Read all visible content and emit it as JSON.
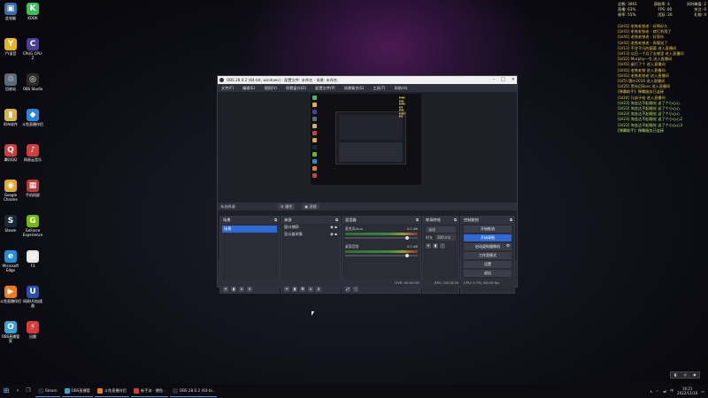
{
  "desktop": {
    "icons": [
      {
        "label": "此电脑",
        "glyph": "▣",
        "color": "#3a6ea5"
      },
      {
        "label": "KOOK",
        "glyph": "K",
        "color": "#3cbf5c"
      },
      {
        "label": "YY语音",
        "glyph": "Y",
        "color": "#e6b422"
      },
      {
        "label": "CRUG CPU-Z",
        "glyph": "C",
        "color": "#4b3f9a"
      },
      {
        "label": "回收站",
        "glyph": "♲",
        "color": "#5a6a7a"
      },
      {
        "label": "OBS Studio",
        "glyph": "◎",
        "color": "#2b2b2b"
      },
      {
        "label": "阿布软件",
        "glyph": "▮",
        "color": "#d8b34a"
      },
      {
        "label": "斗鱼直播伴侣",
        "glyph": "◆",
        "color": "#2a86d8"
      },
      {
        "label": "腾讯QQ",
        "glyph": "Q",
        "color": "#d23c3c"
      },
      {
        "label": "网易云音乐",
        "glyph": "♪",
        "color": "#d23c3c"
      },
      {
        "label": "Google Chrome",
        "glyph": "◉",
        "color": "#e0a82e"
      },
      {
        "label": "手机同屏",
        "glyph": "▦",
        "color": "#b83a3a"
      },
      {
        "label": "Steam",
        "glyph": "S",
        "color": "#1b2838"
      },
      {
        "label": "GeForce Experience",
        "glyph": "G",
        "color": "#76b900"
      },
      {
        "label": "Microsoft Edge",
        "glyph": "e",
        "color": "#1f8fd8"
      },
      {
        "label": "F3",
        "glyph": "▤",
        "color": "#e8e8e8"
      },
      {
        "label": "斗鱼直播伴侣",
        "glyph": "▶",
        "color": "#f07a1a"
      },
      {
        "label": "网易UU加速器",
        "glyph": "U",
        "color": "#2a4fa8"
      },
      {
        "label": "OBS直播管家",
        "glyph": "O",
        "color": "#3aa0d8"
      },
      {
        "label": "迅雷",
        "glyph": "⚡",
        "color": "#d83a3a"
      }
    ]
  },
  "stats": {
    "rows": [
      [
        "总数: 3961",
        "获取率: 4",
        "实时峰值: 2"
      ],
      [
        "直播: 63%",
        "FPS: 60",
        "关注: 0"
      ],
      [
        "帧率: 55%",
        "活跃: 20",
        "礼物: 4"
      ]
    ]
  },
  "chat": [
    {
      "text": "[LV41] 老铁老铁老 : 好啊好久",
      "tone": "c1"
    },
    {
      "text": "[LV41] 老铁老铁老 : 就打到我了",
      "tone": "c1"
    },
    {
      "text": "[LV41] 老铁老铁老 : 好家伙",
      "tone": "c1"
    },
    {
      "text": "[LV41] 老铁老铁老 : 再睡觉了",
      "tone": "c1"
    },
    {
      "text": "[LV13] 不甘平凡的菌菌 进入直播间",
      "tone": "c1"
    },
    {
      "text": "[LV13] 以后一个月了去哪里 进入直播间",
      "tone": "c1"
    },
    {
      "text": "[LV22] Murphy一号 进入直播间",
      "tone": "c1"
    },
    {
      "text": "[LV41] 桌打了个 进入直播间",
      "tone": "c1"
    },
    {
      "text": "[LV41] 老铁老铁 进入直播间",
      "tone": "c1"
    },
    {
      "text": "[LV41] 老铁老铁老 进入直播间",
      "tone": "c1"
    },
    {
      "text": "[LV5] 落叶2016 进入直播间",
      "tone": "c1"
    },
    {
      "text": "[LV25] 黑先后Boss 进入直播间",
      "tone": "c1"
    },
    {
      "text": "[弹幕助手]: 弹幕服务已连接",
      "tone": "c1"
    },
    {
      "text": "[LV24] 兄弟子给 进入直播间",
      "tone": "c1"
    },
    {
      "text": "[LV23] 淘金达不起睡觉 送了个小心心",
      "tone": "c2"
    },
    {
      "text": "[LV23] 淘金达不起睡觉 送了个小心心",
      "tone": "c2"
    },
    {
      "text": "[LV23] 淘金达不起睡觉 送了个小心心",
      "tone": "c2"
    },
    {
      "text": "[LV23] 淘金达不起睡觉 送了个小心心2",
      "tone": "c2"
    },
    {
      "text": "[LV23] 淘金达不起睡觉 送了个小心心3",
      "tone": "c2"
    },
    {
      "text": "[弹幕助手]: 弹幕服务已连接",
      "tone": "c2"
    }
  ],
  "obs": {
    "title": "OBS 28.0.2 (64-bit, windows) - 配置文件: 未命名 - 场景: 未命名",
    "menu": [
      "文件(F)",
      "编辑(E)",
      "视图(V)",
      "停靠窗口(D)",
      "配置文件(P)",
      "场景集合(S)",
      "工具(T)",
      "帮助(H)"
    ],
    "scene_name": "未选择源",
    "attr_btn": "⚙ 属性",
    "filter_btn": "▣ 滤镜",
    "docks": {
      "scenes": {
        "title": "场景",
        "items": [
          "场景"
        ]
      },
      "sources": {
        "title": "来源",
        "items": [
          "窗口捕获",
          "显示器采集"
        ]
      },
      "mixer": {
        "title": "混音器",
        "tracks": [
          {
            "name": "麦克风/Aux",
            "level": "0.0 dB"
          },
          {
            "name": "桌面音频",
            "level": "0.0 dB"
          }
        ]
      },
      "transitions": {
        "title": "转场特效",
        "type": "淡化",
        "duration_label": "时长",
        "duration": "300 ms"
      },
      "controls": {
        "title": "控制按钮",
        "buttons": [
          "开始推流",
          "开始录制",
          "启动虚拟摄像机",
          "工作室模式",
          "设置",
          "退出"
        ]
      }
    },
    "status": {
      "live": "LIVE: 00:00:00",
      "rec": "REC: 00:00:00",
      "cpu": "CPU: 0.7%, 60.00 fps"
    }
  },
  "taskbar": {
    "tasks": [
      {
        "label": "Steam",
        "color": "#1b2838"
      },
      {
        "label": "OBS直播管",
        "color": "#3aa0d8"
      },
      {
        "label": "斗鱼直播伴侣",
        "color": "#f07a1a"
      },
      {
        "label": "新手流 - 爆鱼..",
        "color": "#d83a3a"
      },
      {
        "label": "OBS 28.0.2 (64-bi..",
        "color": "#2b2b2b"
      }
    ],
    "clock_time": "16:21",
    "clock_date": "2022/11/16"
  }
}
